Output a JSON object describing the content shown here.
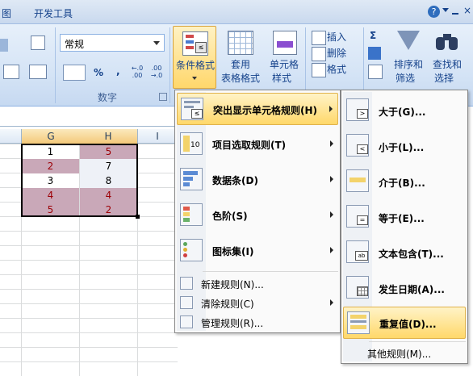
{
  "tabs": {
    "view": "图",
    "developer": "开发工具"
  },
  "help_icon": "help-icon",
  "number_group": {
    "format_value": "常规",
    "label": "数字",
    "currency": "%",
    "comma": ",",
    "inc_dec": ".00",
    "dec_dec": ".00"
  },
  "styles_group": {
    "conditional_format": "条件格式",
    "table_format_line1": "套用",
    "table_format_line2": "表格格式",
    "cell_styles_line1": "单元格",
    "cell_styles_line2": "样式"
  },
  "cells_group": {
    "insert": "插入",
    "delete": "删除",
    "format": "格式"
  },
  "editing_group": {
    "sort_line1": "排序和",
    "sort_line2": "筛选",
    "find_line1": "查找和",
    "find_line2": "选择"
  },
  "sheet": {
    "columns": [
      "G",
      "H",
      "I"
    ],
    "rows": [
      {
        "g": "1",
        "h": "5"
      },
      {
        "g": "2",
        "h": "7"
      },
      {
        "g": "3",
        "h": "8"
      },
      {
        "g": "4",
        "h": "4"
      },
      {
        "g": "5",
        "h": "2"
      }
    ]
  },
  "cf_menu": {
    "items": [
      {
        "label": "突出显示单元格规则(H)"
      },
      {
        "label": "项目选取规则(T)"
      },
      {
        "label": "数据条(D)"
      },
      {
        "label": "色阶(S)"
      },
      {
        "label": "图标集(I)"
      }
    ],
    "small_items": [
      {
        "label": "新建规则(N)..."
      },
      {
        "label": "清除规则(C)"
      },
      {
        "label": "管理规则(R)..."
      }
    ]
  },
  "highlight_menu": {
    "items": [
      {
        "label": "大于(G)..."
      },
      {
        "label": "小于(L)..."
      },
      {
        "label": "介于(B)..."
      },
      {
        "label": "等于(E)..."
      },
      {
        "label": "文本包含(T)..."
      },
      {
        "label": "发生日期(A)..."
      },
      {
        "label": "重复值(D)..."
      }
    ],
    "more": "其他规则(M)..."
  },
  "colors": {
    "highlight_fill": "#c9a8b8",
    "highlight_text": "#9c0006",
    "menu_hover": "#ffd86a"
  }
}
